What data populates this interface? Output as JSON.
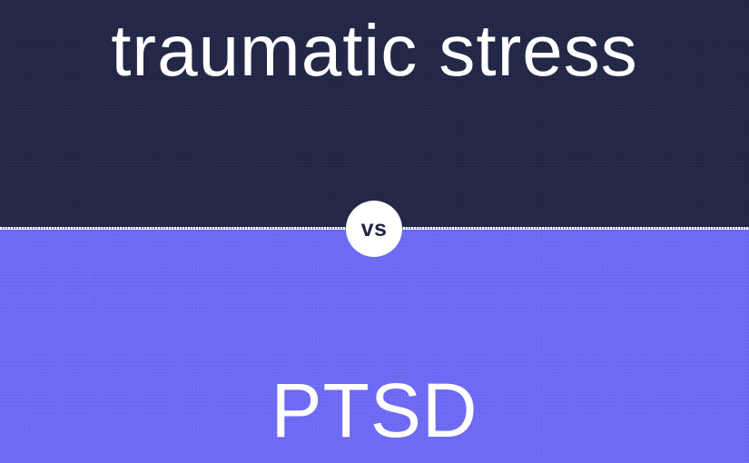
{
  "top": {
    "term": "traumatic stress",
    "background_color": "#212646"
  },
  "bottom": {
    "term": "PTSD",
    "background_color": "#6d69f5"
  },
  "badge": {
    "label": "vs",
    "background_color": "#ffffff",
    "text_color": "#212646"
  }
}
